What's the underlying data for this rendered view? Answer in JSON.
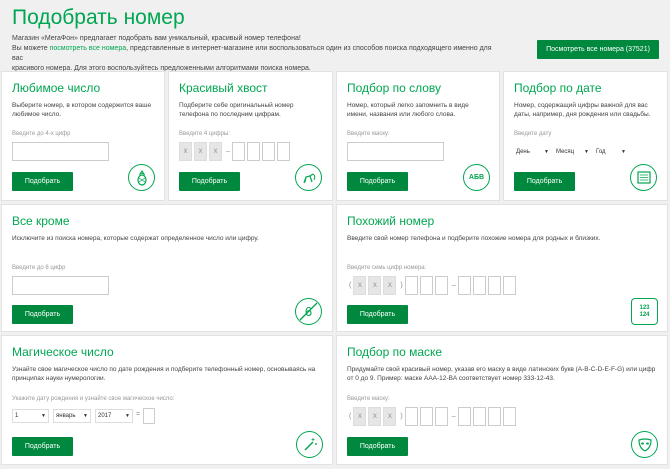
{
  "header": {
    "title": "Подобрать номер",
    "intro_line1": "Магазин «МегаФон» предлагает подобрать вам уникальный, красивый номер телефона!",
    "intro_line2_pre": "Вы можете ",
    "intro_line2_link": "посмотреть все номера",
    "intro_line2_post": ", представленные в интернет-магазине или воспользоваться один из способов поиска подходящего именно для вас",
    "intro_line3": "красивого номера. Для этого воспользуйтесь предложенными алгоритмами поиска номера.",
    "view_all_label": "Посмотреть все номера (37521)"
  },
  "button_label": "Подобрать",
  "cards": {
    "favorite": {
      "title": "Любимое число",
      "desc1": "Выберите номер, в котором содержится ваше",
      "desc2": "любимое число.",
      "hint": "Введите до 4-х цифр"
    },
    "tail": {
      "title": "Красивый хвост",
      "desc1": "Подберите себе оригинальный номер",
      "desc2": "телефона по последним цифрам.",
      "hint": "Введите 4 цифры:",
      "filled": [
        "X",
        "X",
        "X"
      ],
      "dash": "–"
    },
    "word": {
      "title": "Подбор по слову",
      "desc1": "Номер, который легко запомнить в виде",
      "desc2": "имени, названия или любого слова.",
      "hint": "Введите маску:",
      "icon_text": "АБВ"
    },
    "date": {
      "title": "Подбор по дате",
      "desc1": "Номер, содержащий цифры важной для вас",
      "desc2": "даты, например, дня рождения или свадьбы.",
      "hint": "Введите дату",
      "day": "День",
      "month": "Месяц",
      "year": "Год"
    },
    "except": {
      "title": "Все кроме",
      "desc": "Исключите из поиска номера, которые содержат определенное число или цифру.",
      "hint": "Введите до 6 цифр",
      "icon_text": "6"
    },
    "similar": {
      "title": "Похожий номер",
      "desc": "Введите свой номер телефона и подберите похожие номера для родных и близких.",
      "hint": "Введите семь цифр номера:",
      "paren_open": "(",
      "paren_close": ")",
      "filled": [
        "X",
        "X",
        "X"
      ],
      "dash": "–",
      "icon_top": "123",
      "icon_bottom": "124"
    },
    "magic": {
      "title": "Магическое число",
      "desc1": "Узнайте свое магическое число по дате рождения и подберите телефонный номер, основываясь на",
      "desc2": "принципах науки нумерологии.",
      "hint": "Укажите дату рождения и узнайте свое магическое число:",
      "day": "1",
      "month": "январь",
      "year": "2017",
      "eq": "="
    },
    "mask": {
      "title": "Подбор по маске",
      "desc1": "Придумайте свой красивый номер, указав его маску в виде латинских букв (A-B-C-D-E-F-G) или цифр",
      "desc2": "от 0 до 9. Пример: маске AAA-12-BA соответствует номер 333-12-43.",
      "hint": "Введите маску:",
      "paren_open": "(",
      "paren_close": ")",
      "filled": [
        "X",
        "X",
        "X"
      ],
      "dash": "–"
    }
  },
  "colors": {
    "brand_green": "#00a651",
    "button_green": "#00893e"
  }
}
